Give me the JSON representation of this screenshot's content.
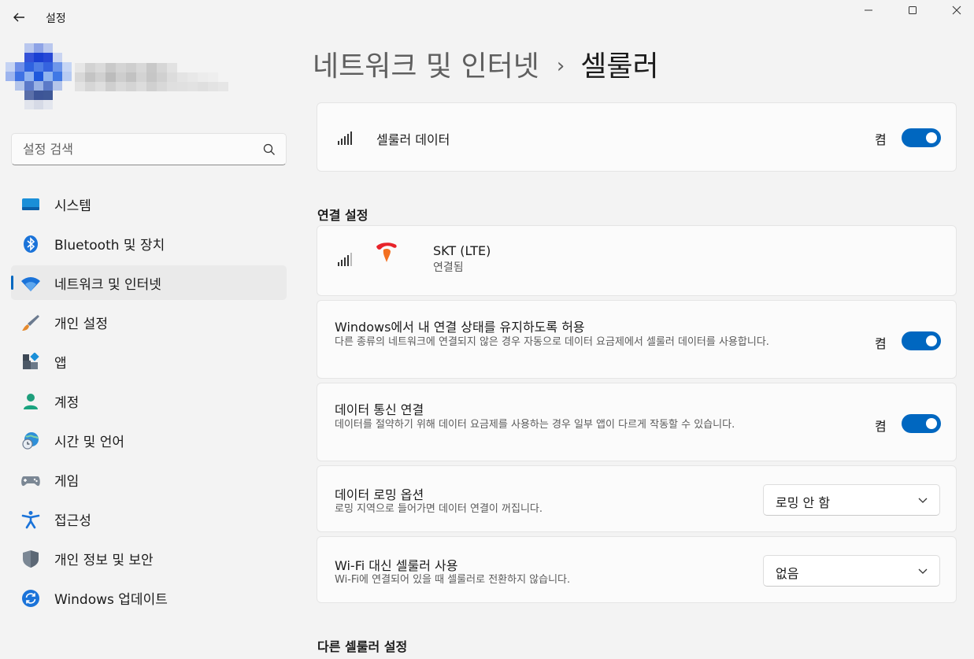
{
  "window": {
    "app_title": "설정",
    "controls": {
      "minimize": "—",
      "maximize": "☐",
      "close": "✕"
    }
  },
  "search": {
    "placeholder": "설정 검색"
  },
  "sidebar": {
    "items": [
      {
        "label": "시스템",
        "icon": "system-icon"
      },
      {
        "label": "Bluetooth 및 장치",
        "icon": "bluetooth-icon"
      },
      {
        "label": "네트워크 및 인터넷",
        "icon": "wifi-icon",
        "active": true
      },
      {
        "label": "개인 설정",
        "icon": "paintbrush-icon"
      },
      {
        "label": "앱",
        "icon": "apps-icon"
      },
      {
        "label": "계정",
        "icon": "account-icon"
      },
      {
        "label": "시간 및 언어",
        "icon": "time-language-icon"
      },
      {
        "label": "게임",
        "icon": "gamepad-icon"
      },
      {
        "label": "접근성",
        "icon": "accessibility-icon"
      },
      {
        "label": "개인 정보 및 보안",
        "icon": "shield-icon"
      },
      {
        "label": "Windows 업데이트",
        "icon": "update-icon"
      }
    ]
  },
  "header": {
    "parent": "네트워크 및 인터넷",
    "separator": "›",
    "current": "셀룰러"
  },
  "cellular": {
    "label": "셀룰러 데이터",
    "state": "켬",
    "on": true
  },
  "sections": {
    "connection": "연결 설정",
    "other": "다른 셀룰러 설정"
  },
  "carrier": {
    "name": "SKT (LTE)",
    "status": "연결됨"
  },
  "settings": {
    "keep_connected": {
      "title": "Windows에서 내 연결 상태를 유지하도록 허용",
      "desc": "다른 종류의 네트워크에 연결되지 않은 경우 자동으로 데이터 요금제에서 셀룰러 데이터를 사용합니다.",
      "state": "켬",
      "on": true
    },
    "data_connection": {
      "title": "데이터 통신 연결",
      "desc": "데이터를 절약하기 위해 데이터 요금제를 사용하는 경우 일부 앱이 다르게 작동할 수 있습니다.",
      "state": "켬",
      "on": true
    },
    "roaming": {
      "title": "데이터 로밍 옵션",
      "desc": "로밍 지역으로 들어가면 데이터 연결이 꺼집니다.",
      "value": "로밍 안 함"
    },
    "wifi_instead": {
      "title": "Wi-Fi 대신 셀룰러 사용",
      "desc": "Wi-Fi에 연결되어 있을 때 셀룰러로 전환하지 않습니다.",
      "value": "없음"
    }
  },
  "colors": {
    "accent": "#0067c0",
    "background": "#f3f3f3",
    "card": "#fbfbfb"
  }
}
